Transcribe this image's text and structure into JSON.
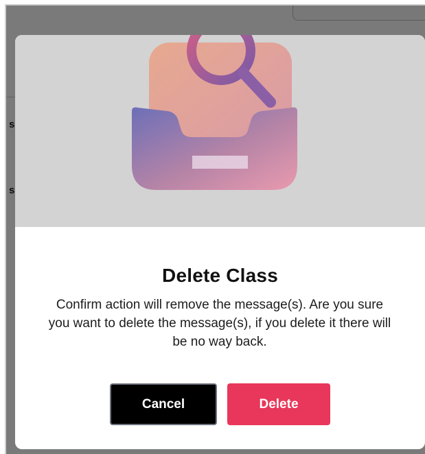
{
  "modal": {
    "title": "Delete Class",
    "message": "Confirm action will remove the message(s). Are you sure you want to delete the message(s), if you delete it there will be no way back.",
    "cancel_label": "Cancel",
    "delete_label": "Delete",
    "illustration_icon": "search-inbox-icon"
  },
  "background": {
    "fragments": [
      "s",
      "s"
    ]
  },
  "colors": {
    "overlay": "rgba(0,0,0,0.52)",
    "delete_button": "#e8375a",
    "cancel_button": "#000000",
    "cancel_border": "#6e7280",
    "hero_background": "#d3d3d3"
  }
}
